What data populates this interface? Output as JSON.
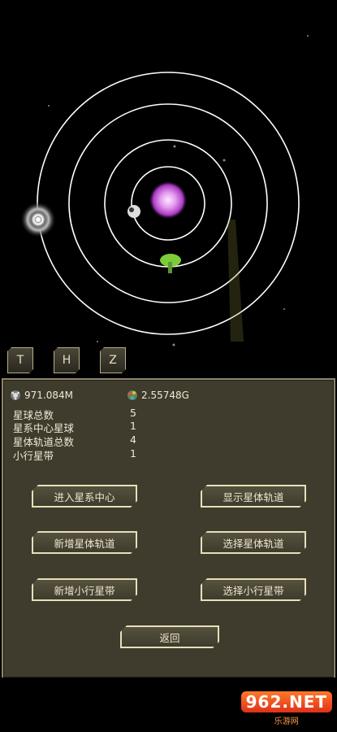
{
  "mode_buttons": [
    "T",
    "H",
    "Z"
  ],
  "resources": {
    "energy": "971.084M",
    "mass": "2.55748G"
  },
  "stats": [
    {
      "label": "星球总数",
      "value": "5"
    },
    {
      "label": "星系中心星球",
      "value": "1"
    },
    {
      "label": "星体轨道总数",
      "value": "4"
    },
    {
      "label": "小行星带",
      "value": "1"
    }
  ],
  "buttons": {
    "enter_center": "进入星系中心",
    "show_orbits": "显示星体轨道",
    "add_orbit": "新增星体轨道",
    "select_orbit": "选择星体轨道",
    "add_belt": "新增小行星带",
    "select_belt": "选择小行星带",
    "back": "返回"
  },
  "watermark": {
    "logo": "962.NET",
    "site": "乐游网"
  },
  "colors": {
    "panel": "#3f3b2d",
    "border": "#8f8566",
    "star": "#d070e8",
    "planet": "#88d84a"
  }
}
